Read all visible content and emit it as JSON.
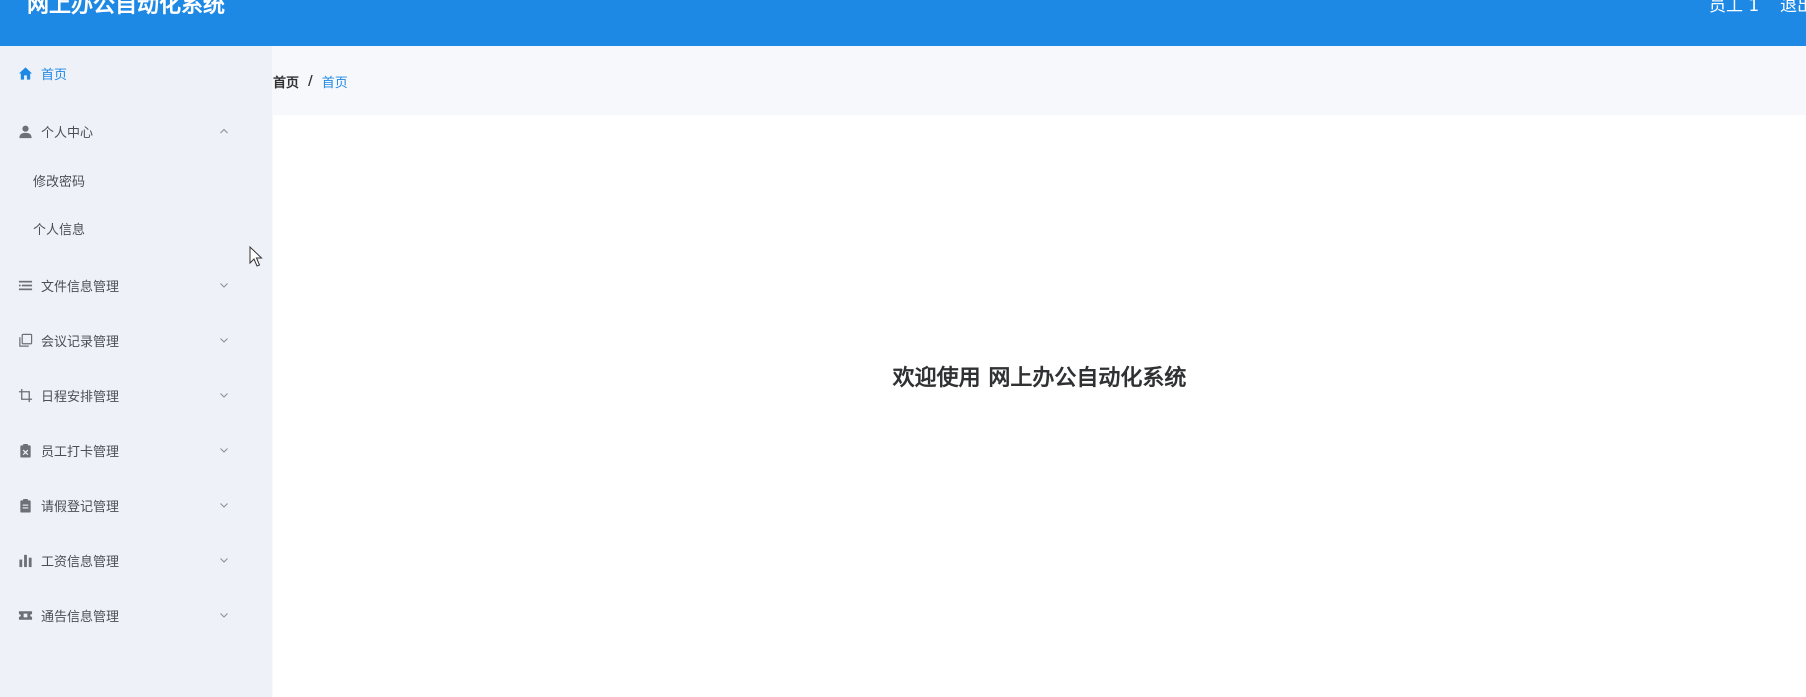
{
  "header": {
    "title": "网上办公自动化系统",
    "user": "员工 1",
    "logout": "退出"
  },
  "sidebar": {
    "items": [
      {
        "label": "首页",
        "icon": "home-icon",
        "active": true
      },
      {
        "label": "个人中心",
        "icon": "user-icon",
        "expanded": true,
        "children": [
          {
            "label": "修改密码"
          },
          {
            "label": "个人信息"
          }
        ]
      },
      {
        "label": "文件信息管理",
        "icon": "list-icon"
      },
      {
        "label": "会议记录管理",
        "icon": "copy-icon"
      },
      {
        "label": "日程安排管理",
        "icon": "crop-icon"
      },
      {
        "label": "员工打卡管理",
        "icon": "clipboard-x-icon"
      },
      {
        "label": "请假登记管理",
        "icon": "clipboard-icon"
      },
      {
        "label": "工资信息管理",
        "icon": "bar-chart-icon"
      },
      {
        "label": "通告信息管理",
        "icon": "ticket-icon"
      }
    ]
  },
  "breadcrumb": {
    "home": "首页",
    "separator": "/",
    "current": "首页"
  },
  "main": {
    "welcome": "欢迎使用 网上办公自动化系统"
  },
  "colors": {
    "primary": "#1e88e5",
    "sidebar_bg": "#eef2f8",
    "text": "#303133"
  }
}
